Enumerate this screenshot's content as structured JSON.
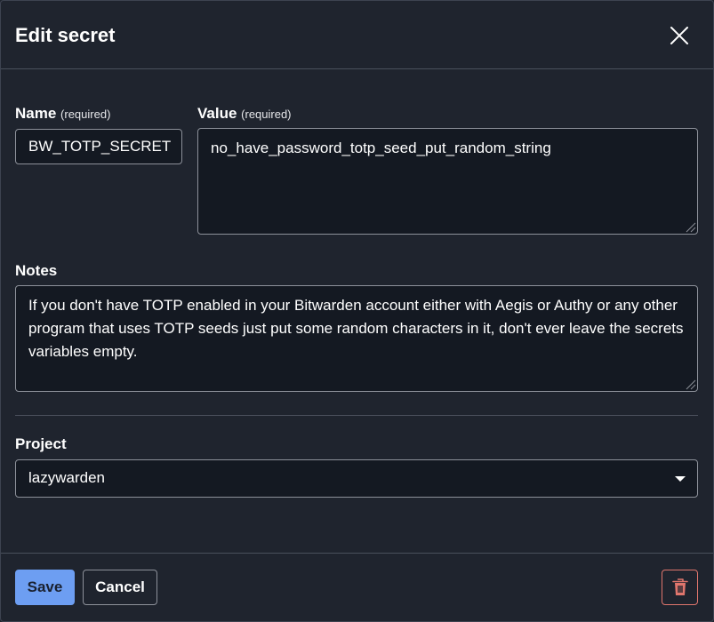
{
  "dialog": {
    "title": "Edit secret",
    "close_icon": "close-icon"
  },
  "form": {
    "name": {
      "label": "Name",
      "required_hint": "(required)",
      "value": "BW_TOTP_SECRET"
    },
    "value": {
      "label": "Value",
      "required_hint": "(required)",
      "value": "no_have_password_totp_seed_put_random_string"
    },
    "notes": {
      "label": "Notes",
      "value": "If you don't have TOTP enabled in your Bitwarden account either with Aegis or Authy or any other program that uses TOTP seeds just put some random characters in it, don't ever leave the secrets variables empty."
    },
    "project": {
      "label": "Project",
      "selected": "lazywarden"
    }
  },
  "footer": {
    "save_label": "Save",
    "cancel_label": "Cancel",
    "delete_icon": "trash-icon"
  },
  "colors": {
    "background": "#1f242e",
    "field_background": "#141922",
    "primary_button": "#6d9ef2",
    "danger": "#e0766d"
  }
}
